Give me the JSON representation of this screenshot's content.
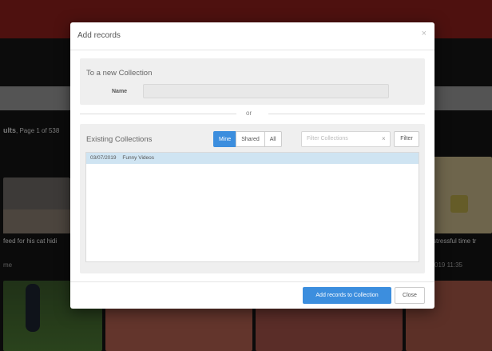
{
  "background": {
    "results_label": "ults",
    "results_page": "Page 1 of 538",
    "card_left_caption": "feed for his cat hidi",
    "card_left_sub": "me",
    "card_right_caption": "stressful time tr",
    "card_right_sub": "019 11:35",
    "accent_color": "#8e1f1c"
  },
  "modal": {
    "title": "Add records",
    "close_icon": "×",
    "new_collection": {
      "title": "To a new Collection",
      "name_label": "Name",
      "name_value": ""
    },
    "or_text": "or",
    "existing": {
      "title": "Existing Collections",
      "tabs": [
        "Mine",
        "Shared",
        "All"
      ],
      "active_tab": "Mine",
      "filter_placeholder": "Filter Collections",
      "filter_clear": "×",
      "filter_button": "Filter",
      "collections": [
        {
          "date": "03/07/2019",
          "name": "Funny Videos",
          "selected": true
        }
      ]
    },
    "footer": {
      "primary_label": "Add records to Collection",
      "close_label": "Close"
    },
    "primary_color": "#3c8ede"
  }
}
